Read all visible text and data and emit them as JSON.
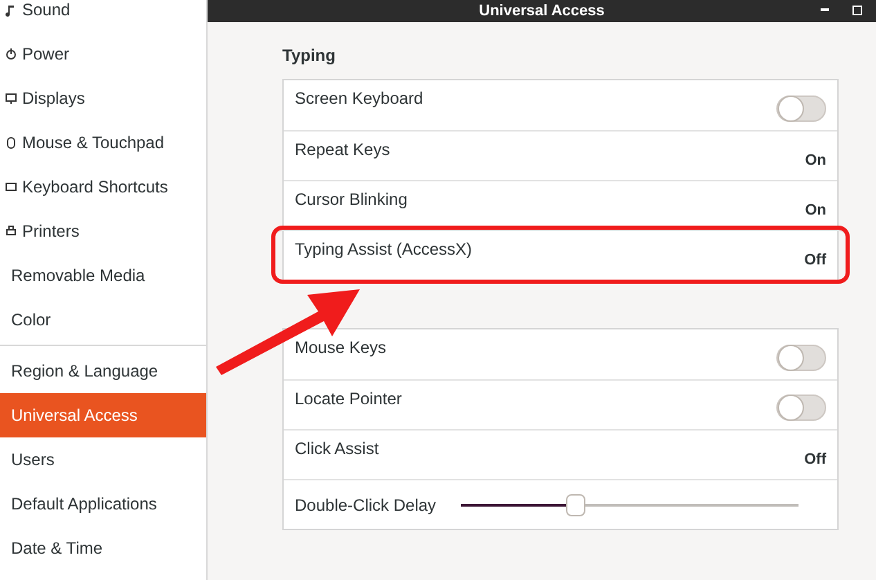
{
  "window": {
    "title": "Universal Access"
  },
  "sidebar": {
    "items": [
      {
        "label": "Sound",
        "selected": false
      },
      {
        "label": "Power",
        "selected": false
      },
      {
        "label": "Displays",
        "selected": false
      },
      {
        "label": "Mouse & Touchpad",
        "selected": false
      },
      {
        "label": "Keyboard Shortcuts",
        "selected": false
      },
      {
        "label": "Printers",
        "selected": false
      },
      {
        "label": "Removable Media",
        "selected": false
      },
      {
        "label": "Color",
        "selected": false
      },
      {
        "label": "Region & Language",
        "selected": false
      },
      {
        "label": "Universal Access",
        "selected": true
      },
      {
        "label": "Users",
        "selected": false
      },
      {
        "label": "Default Applications",
        "selected": false
      },
      {
        "label": "Date & Time",
        "selected": false
      }
    ]
  },
  "typing": {
    "heading": "Typing",
    "rows": [
      {
        "kind": "switch",
        "label": "Screen Keyboard",
        "on": false
      },
      {
        "kind": "value",
        "label": "Repeat Keys",
        "value": "On"
      },
      {
        "kind": "value",
        "label": "Cursor Blinking",
        "value": "On"
      },
      {
        "kind": "value",
        "label": "Typing Assist (AccessX)",
        "value": "Off",
        "highlighted": true
      }
    ]
  },
  "pointing": {
    "rows": [
      {
        "kind": "switch",
        "label": "Mouse Keys",
        "on": false
      },
      {
        "kind": "switch",
        "label": "Locate Pointer",
        "on": false
      },
      {
        "kind": "value",
        "label": "Click Assist",
        "value": "Off"
      },
      {
        "kind": "slider",
        "label": "Double-Click Delay",
        "level": 0.34
      }
    ]
  }
}
